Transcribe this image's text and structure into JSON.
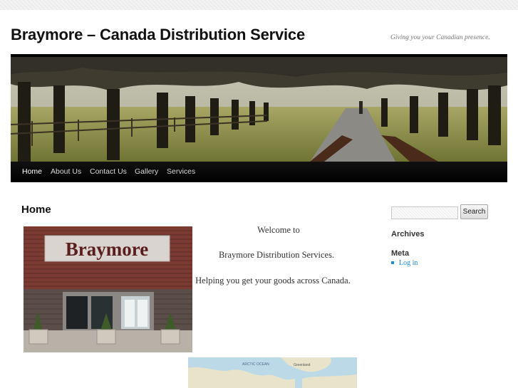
{
  "site": {
    "title": "Braymore – Canada Distribution Service",
    "tagline": "Giving you your Canadian presence."
  },
  "nav": {
    "items": [
      {
        "label": "Home",
        "active": true
      },
      {
        "label": "About Us",
        "active": false
      },
      {
        "label": "Contact Us",
        "active": false
      },
      {
        "label": "Gallery",
        "active": false
      },
      {
        "label": "Services",
        "active": false
      }
    ]
  },
  "content": {
    "page_title": "Home",
    "photo_sign": "Braymore",
    "lines": [
      "Welcome to",
      "Braymore Distribution Services.",
      "Helping you get your goods across Canada."
    ],
    "map_labels": [
      "ARCTIC OCEAN",
      "Greenland"
    ]
  },
  "sidebar": {
    "search": {
      "value": "",
      "button_label": "Search"
    },
    "archives_title": "Archives",
    "meta_title": "Meta",
    "meta_links": [
      "Log in"
    ]
  },
  "colors": {
    "nav_bg": "#000000",
    "link": "#1b8be0",
    "header_bar": "#000000"
  }
}
